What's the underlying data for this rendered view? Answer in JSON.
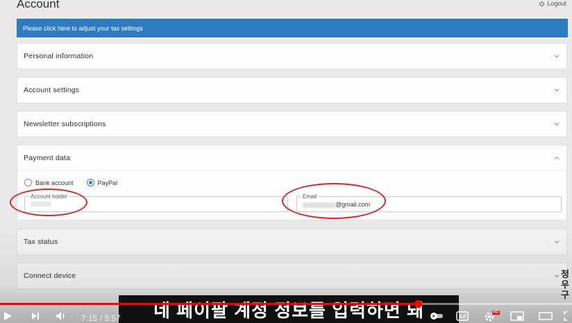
{
  "page": {
    "title": "Account",
    "logout_label": "Logout"
  },
  "banner": {
    "text": "Please click here to adjust your tax settings",
    "color": "#2f7bc2"
  },
  "panels": {
    "personal": "Personal information",
    "account": "Account settings",
    "newsletter": "Newsletter subscriptions",
    "payment": "Payment data",
    "tax": "Tax status",
    "connect": "Connect device"
  },
  "payment": {
    "options": [
      {
        "label": "Bank account",
        "selected": false
      },
      {
        "label": "PayPal",
        "selected": true
      }
    ],
    "account_holder": {
      "label": "Account holder",
      "value": ""
    },
    "email": {
      "label": "Email",
      "value": "@gmail.com"
    }
  },
  "video": {
    "subtitle": "네 페이팔 계정 정보를 입력하면 돼",
    "side_text": "정우 구",
    "time": "7:15 / 9:57",
    "progress": 0.731,
    "hd_badge": "HD"
  },
  "icons": [
    "power-icon",
    "chevron-down-icon",
    "chevron-up-icon",
    "play-icon",
    "next-icon",
    "volume-icon",
    "autoplay-toggle",
    "subtitles-icon",
    "settings-icon",
    "miniplayer-icon",
    "theater-icon"
  ]
}
